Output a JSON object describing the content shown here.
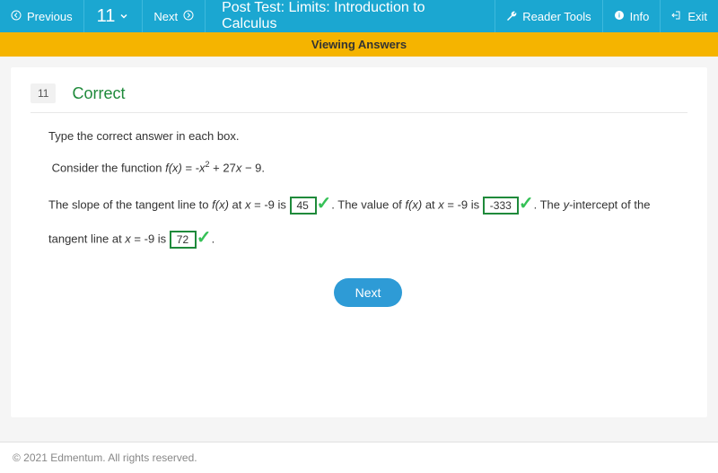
{
  "header": {
    "prev_label": "Previous",
    "page_num": "11",
    "next_label": "Next",
    "title": "Post Test: Limits: Introduction to Calculus",
    "reader_tools": "Reader Tools",
    "info": "Info",
    "exit": "Exit"
  },
  "banner": {
    "text": "Viewing Answers"
  },
  "question": {
    "number": "11",
    "status": "Correct",
    "instruction": "Type the correct answer in each box.",
    "consider_prefix": "Consider the function ",
    "fx_label": "f(x)",
    "eq_part": " = -",
    "x_label": "x",
    "plus_part": " + 27",
    "minus_part": " − 9.",
    "line1a": "The slope of the tangent line to ",
    "line1b": " at ",
    "line1c": " = -9 is  ",
    "ans1": "45",
    "line2a": ". The value of ",
    "line2b": " at ",
    "line2c": " = -9 is   ",
    "ans2": "-333",
    "line3a": ". The ",
    "y_label": "y",
    "line3b": "-intercept of the tangent line at ",
    "line3c": " = -9 is  ",
    "ans3": "72",
    "period": "."
  },
  "next_button": "Next",
  "footer": "© 2021 Edmentum. All rights reserved."
}
